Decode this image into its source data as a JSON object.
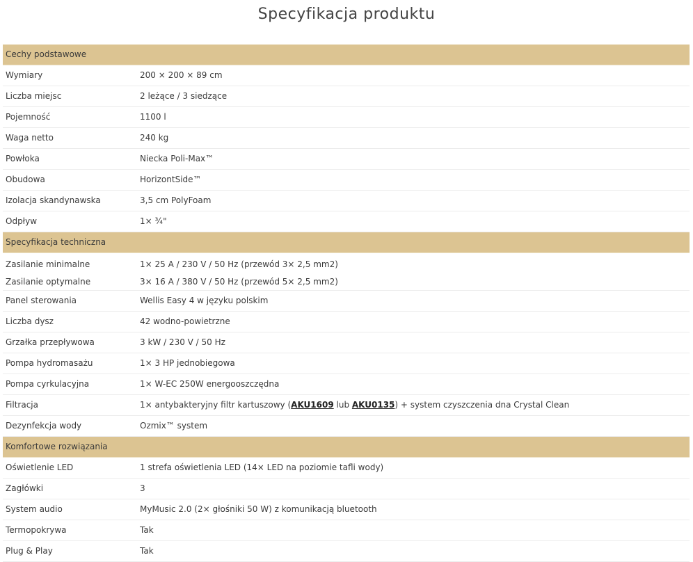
{
  "page_title": "Specyfikacja produktu",
  "sections": {
    "basic": {
      "title": "Cechy podstawowe",
      "rows": [
        {
          "label": "Wymiary",
          "value": "200 × 200 × 89 cm"
        },
        {
          "label": "Liczba miejsc",
          "value": "2 leżące / 3 siedzące"
        },
        {
          "label": "Pojemność",
          "value": "1100 l"
        },
        {
          "label": "Waga netto",
          "value": "240 kg"
        },
        {
          "label": "Powłoka",
          "value": "Niecka Poli-Max™"
        },
        {
          "label": "Obudowa",
          "value": "HorizontSide™"
        },
        {
          "label": "Izolacja skandynawska",
          "value": "3,5 cm PolyFoam"
        },
        {
          "label": "Odpływ",
          "value": " 1× ¾\""
        }
      ]
    },
    "technical": {
      "title": "Specyfikacja techniczna",
      "power": {
        "label_min": "Zasilanie minimalne",
        "label_opt": "Zasilanie optymalne",
        "value_min": "1× 25 A / 230 V / 50 Hz (przewód 3× 2,5 mm2)",
        "value_opt": "3× 16 A / 380 V / 50 Hz (przewód 5× 2,5 mm2)"
      },
      "rows": [
        {
          "label": "Panel sterowania",
          "value": "Wellis Easy 4 w języku polskim"
        },
        {
          "label": "Liczba dysz",
          "value": "42 wodno-powietrzne"
        },
        {
          "label": "Grzałka przepływowa",
          "value": "3 kW / 230 V / 50 Hz"
        },
        {
          "label": "Pompa hydromasażu",
          "value": "1× 3 HP jednobiegowa"
        },
        {
          "label": "Pompa cyrkulacyjna",
          "value": "1× W-EC 250W energooszczędna"
        }
      ],
      "filtration": {
        "label": "Filtracja",
        "prefix": "1× antybakteryjny filtr kartuszowy (",
        "link1": "AKU1609",
        "middle": " lub ",
        "link2": "AKU0135",
        "suffix": ") + system czyszczenia dna Crystal Clean"
      },
      "disinfection": {
        "label": "Dezynfekcja wody",
        "value": "Ozmix™ system"
      }
    },
    "comfort": {
      "title": "Komfortowe rozwiązania",
      "rows": [
        {
          "label": "Oświetlenie LED",
          "value": "1 strefa oświetlenia LED (14× LED na poziomie tafli wody)"
        },
        {
          "label": "Zagłówki",
          "value": "3"
        },
        {
          "label": "System audio",
          "value": "MyMusic 2.0 (2× głośniki 50 W) z komunikacją bluetooth"
        },
        {
          "label": "Termopokrywa",
          "value": "Tak"
        },
        {
          "label": "Plug & Play",
          "value": "Tak"
        }
      ]
    }
  },
  "colors": {
    "section_header_bg": "#dcc492",
    "row_border": "#ececec",
    "text": "#3a3a3a"
  }
}
